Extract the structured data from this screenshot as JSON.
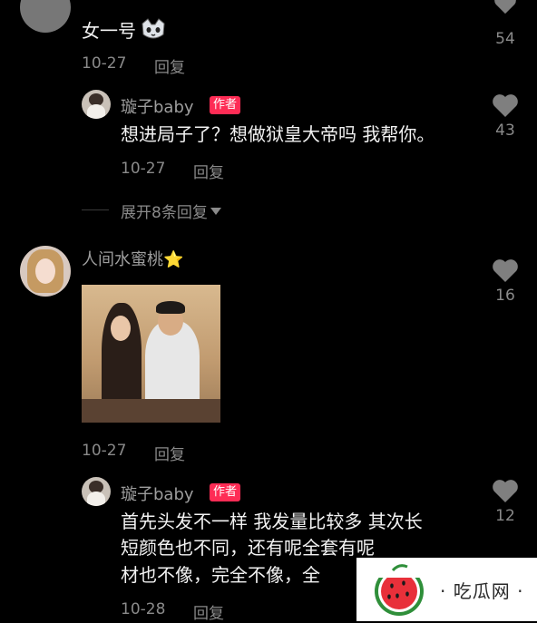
{
  "comments": [
    {
      "text": "女一号",
      "date": "10-27",
      "reply_label": "回复",
      "likes": "54"
    },
    {
      "author": "璇子baby",
      "badge": "作者",
      "text": "想进局子了？想做狱皇大帝吗 我帮你。",
      "date": "10-27",
      "reply_label": "回复",
      "likes": "43"
    },
    {
      "author": "人间水蜜桃⭐",
      "date": "10-27",
      "reply_label": "回复",
      "likes": "16"
    },
    {
      "author": "璇子baby",
      "badge": "作者",
      "text_lines": [
        "首先头发不一样 我发量比较多 其次长",
        "短颜色也不同，还有呢全套有呢",
        "材也不像，完全不像，全"
      ],
      "date": "10-28",
      "reply_label": "回复",
      "likes": "12"
    }
  ],
  "expand_replies": "展开8条回复",
  "watermark": {
    "text": "· 吃瓜网 ·"
  },
  "colors": {
    "background": "#000000",
    "badge": "#fe2c55",
    "muted": "#8a8a8a",
    "watermark_red": "#e8303a",
    "watermark_green": "#2f8f3a"
  }
}
